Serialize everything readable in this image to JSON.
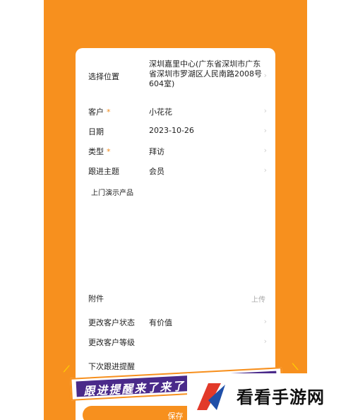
{
  "form": {
    "location": {
      "label": "选择位置",
      "value": "深圳嘉里中心(广东省深圳市广东省深圳市罗湖区人民南路2008号604室)"
    },
    "customer": {
      "label": "客户",
      "required_mark": "*",
      "value": "小花花"
    },
    "date": {
      "label": "日期",
      "value": "2023-10-26"
    },
    "type": {
      "label": "类型",
      "required_mark": "*",
      "value": "拜访"
    },
    "topic": {
      "label": "跟进主题",
      "value": "会员"
    },
    "notes": {
      "text": "上门演示产品"
    },
    "attachment": {
      "label": "附件",
      "action": "上传"
    },
    "customer_status": {
      "label": "更改客户状态",
      "value": "有价值"
    },
    "customer_level": {
      "label": "更改客户等级",
      "value": ""
    },
    "next_reminder": {
      "label": "下次跟进提醒"
    },
    "save_label": "保存"
  },
  "banner": {
    "text": "跟进提醒来了来了"
  },
  "watermark": {
    "text": "看看手游网"
  },
  "colors": {
    "accent": "#f7901e",
    "banner_bg": "#4a2a8a",
    "logo_red": "#e23a2a",
    "logo_blue": "#1f4fa8"
  }
}
